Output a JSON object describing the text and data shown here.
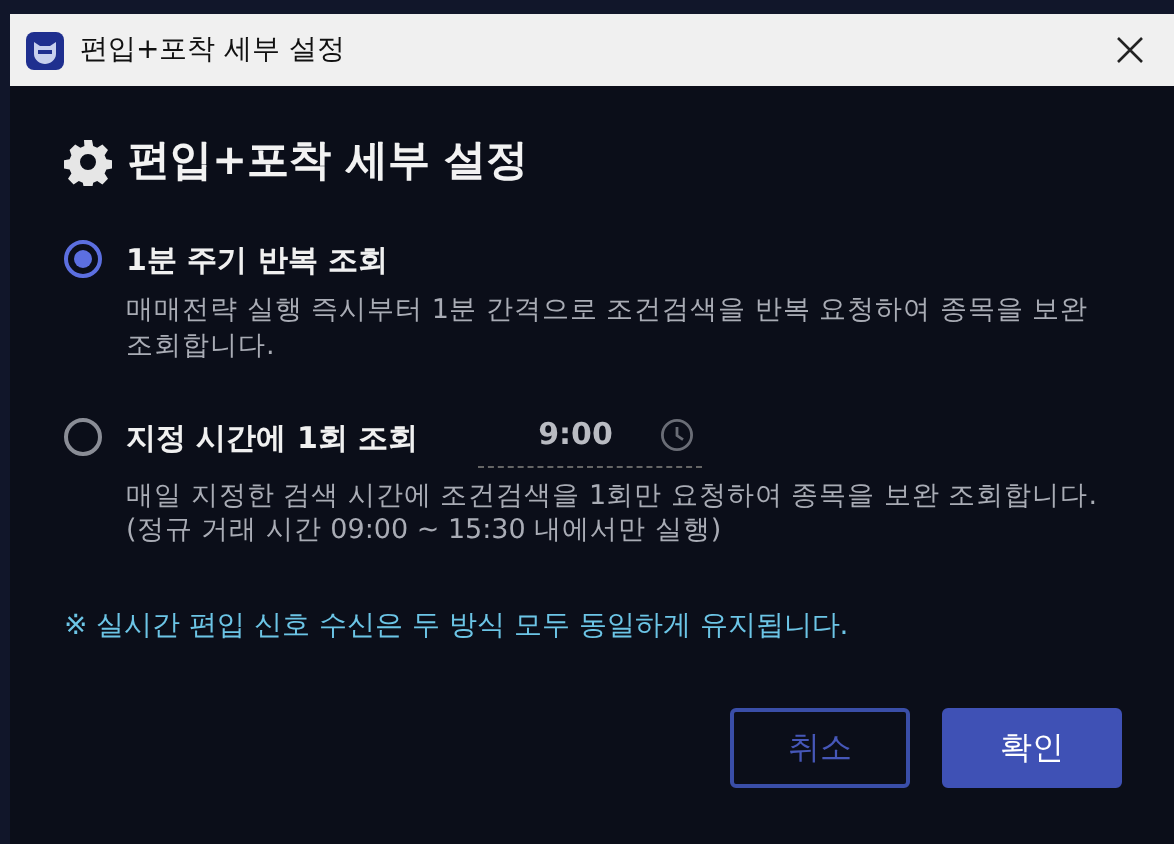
{
  "window": {
    "title": "편입+포착 세부 설정"
  },
  "heading": "편입+포착 세부 설정",
  "options": [
    {
      "label": "1분 주기 반복 조회",
      "selected": true,
      "description": "매매전략 실행 즉시부터 1분 간격으로 조건검색을 반복 요청하여 종목을 보완 조회합니다."
    },
    {
      "label": "지정 시간에 1회 조회",
      "selected": false,
      "time": "9:00",
      "description": "매일 지정한 검색 시간에 조건검색을 1회만 요청하여 종목을 보완 조회합니다. (정규 거래 시간 09:00 ~ 15:30 내에서만 실행)"
    }
  ],
  "note": "※ 실시간 편입 신호 수신은 두 방식 모두 동일하게 유지됩니다.",
  "buttons": [
    {
      "label": "취소",
      "kind": "secondary"
    },
    {
      "label": "확인",
      "kind": "primary"
    }
  ]
}
